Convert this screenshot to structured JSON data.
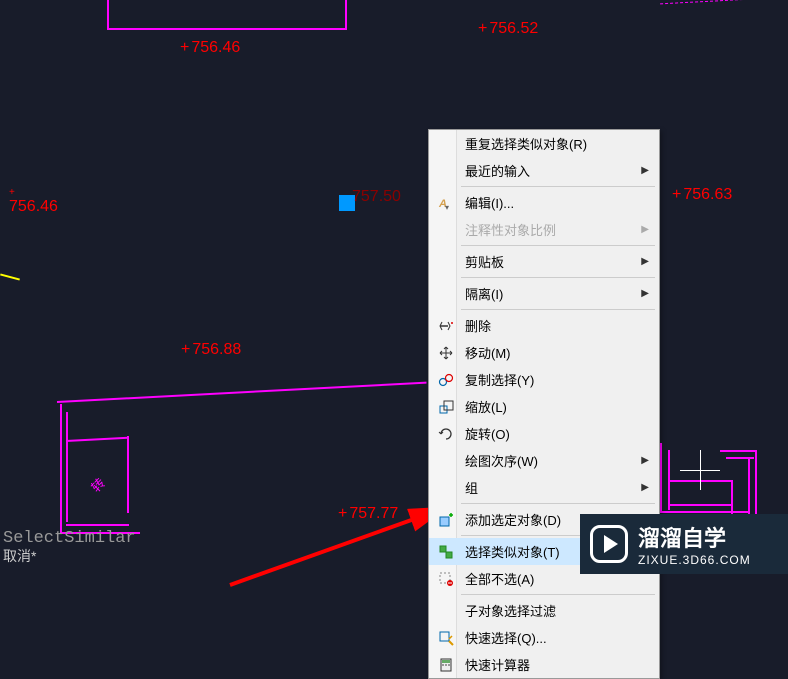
{
  "canvas": {
    "labels": {
      "top_right": "756.52",
      "left_mid": "756.46",
      "upper_left": "756.46",
      "center": "757.50",
      "right": "756.63",
      "mid_lower": "756.88",
      "bottom": "757.77"
    },
    "chinese_text": "转",
    "command_text": "SelectSimilar",
    "cancel_text": "取消*"
  },
  "context_menu": {
    "items": [
      {
        "label": "重复选择类似对象(R)",
        "icon": null,
        "submenu": false
      },
      {
        "label": "最近的输入",
        "icon": null,
        "submenu": true
      },
      {
        "separator": true
      },
      {
        "label": "编辑(I)...",
        "icon": "edit",
        "submenu": false
      },
      {
        "label": "注释性对象比例",
        "icon": null,
        "submenu": true,
        "disabled": true
      },
      {
        "separator": true
      },
      {
        "label": "剪贴板",
        "icon": null,
        "submenu": true
      },
      {
        "separator": true
      },
      {
        "label": "隔离(I)",
        "icon": null,
        "submenu": true
      },
      {
        "separator": true
      },
      {
        "label": "删除",
        "icon": "delete",
        "submenu": false
      },
      {
        "label": "移动(M)",
        "icon": "move",
        "submenu": false
      },
      {
        "label": "复制选择(Y)",
        "icon": "copy",
        "submenu": false
      },
      {
        "label": "缩放(L)",
        "icon": "scale",
        "submenu": false
      },
      {
        "label": "旋转(O)",
        "icon": "rotate",
        "submenu": false
      },
      {
        "label": "绘图次序(W)",
        "icon": null,
        "submenu": true
      },
      {
        "label": "组",
        "icon": null,
        "submenu": true
      },
      {
        "separator": true
      },
      {
        "label": "添加选定对象(D)",
        "icon": "add-select",
        "submenu": false
      },
      {
        "separator": true
      },
      {
        "label": "选择类似对象(T)",
        "icon": "select-similar",
        "submenu": false,
        "highlighted": true
      },
      {
        "label": "全部不选(A)",
        "icon": "deselect",
        "submenu": false
      },
      {
        "separator": true
      },
      {
        "label": "子对象选择过滤",
        "icon": null,
        "submenu": true
      },
      {
        "label": "快速选择(Q)...",
        "icon": "quick-select",
        "submenu": false
      },
      {
        "label": "快速计算器",
        "icon": "calculator",
        "submenu": false
      }
    ]
  },
  "watermark": {
    "title": "溜溜自学",
    "url": "ZIXUE.3D66.COM"
  }
}
